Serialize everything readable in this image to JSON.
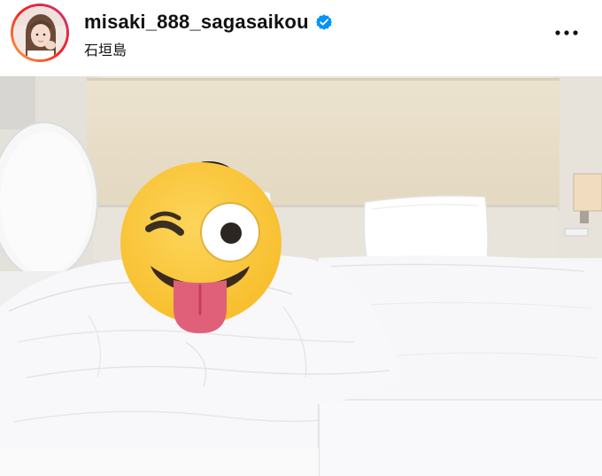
{
  "post": {
    "username": "misaki_888_sagasaikou",
    "location": "石垣島",
    "verified": true
  },
  "icons": {
    "verified": "verified-badge-icon",
    "more": "more-options-icon",
    "avatar": "profile-photo",
    "sticker": "winking-face-with-tongue-emoji"
  },
  "colors": {
    "verified_blue": "#0095f6",
    "text": "#111111",
    "story_ring_start": "#fcb045",
    "story_ring_end": "#c13584",
    "emoji_yellow": "#fcc934"
  }
}
